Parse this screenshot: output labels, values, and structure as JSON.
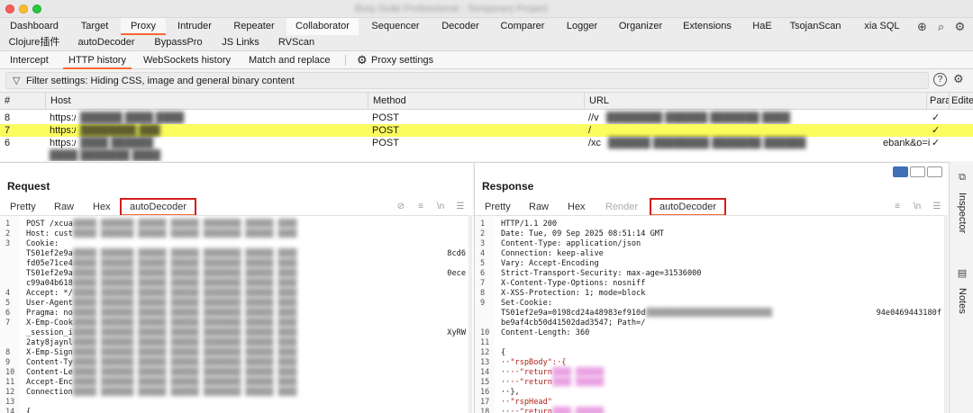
{
  "window": {
    "title": "Burp Suite Professional - Temporary Project"
  },
  "main_tabs_row1": [
    "Dashboard",
    "Target",
    "Proxy",
    "Intruder",
    "Repeater",
    "Collaborator",
    "Sequencer",
    "Decoder",
    "Comparer",
    "Logger",
    "Organizer",
    "Extensions",
    "HaE",
    "TsojanScan",
    "xia SQL"
  ],
  "main_tabs_row2": [
    "Clojure插件",
    "autoDecoder",
    "BypassPro",
    "JS Links",
    "RVScan"
  ],
  "active_main_tab": "Proxy",
  "proxy_tabs": [
    "Intercept",
    "HTTP history",
    "WebSockets history",
    "Match and replace"
  ],
  "proxy_settings_label": "Proxy settings",
  "active_proxy_tab": "HTTP history",
  "filter": {
    "text": "Filter settings: Hiding CSS, image and general binary content"
  },
  "history_table": {
    "columns": [
      "#",
      "Host",
      "Method",
      "URL",
      "Para",
      "Edite"
    ],
    "rows": [
      {
        "num": "8",
        "host": "https://",
        "method": "POST",
        "url": "//v",
        "params": "✓",
        "selected": false
      },
      {
        "num": "7",
        "host": "https://",
        "method": "POST",
        "url": "/",
        "params": "✓",
        "selected": true
      },
      {
        "num": "6",
        "host": "https://",
        "method": "POST",
        "url": "/xc",
        "url_tail": "ebank&o=i",
        "params": "✓",
        "selected": false
      }
    ]
  },
  "request_panel": {
    "title": "Request",
    "tabs": [
      "Pretty",
      "Raw",
      "Hex",
      "autoDecoder"
    ],
    "active_tab": "autoDecoder",
    "lines": [
      {
        "n": "1",
        "text": "POST /xcua"
      },
      {
        "n": "2",
        "text": "Host: cust"
      },
      {
        "n": "3",
        "text": "Cookie:"
      },
      {
        "n": "",
        "text": "TS01ef2e9a",
        "tail": "8cd6"
      },
      {
        "n": "",
        "text": "fd05e71ce4"
      },
      {
        "n": "",
        "text": "TS01ef2e9a",
        "tail": "0ece"
      },
      {
        "n": "",
        "text": "c99a04b618"
      },
      {
        "n": "4",
        "text": "Accept: */"
      },
      {
        "n": "5",
        "text": "User-Agent"
      },
      {
        "n": "6",
        "text": "Pragma: no"
      },
      {
        "n": "7",
        "text": "X-Emp-Cook"
      },
      {
        "n": "",
        "text": "_session_i",
        "tail": "XyRW"
      },
      {
        "n": "",
        "text": "2aty8jaynl"
      },
      {
        "n": "8",
        "text": "X-Emp-Sign"
      },
      {
        "n": "9",
        "text": "Content-Ty"
      },
      {
        "n": "10",
        "text": "Content-Le"
      },
      {
        "n": "11",
        "text": "Accept-Enc"
      },
      {
        "n": "12",
        "text": "Connection"
      },
      {
        "n": "13",
        "text": ""
      },
      {
        "n": "14",
        "text": "{"
      }
    ]
  },
  "response_panel": {
    "title": "Response",
    "tabs": [
      "Pretty",
      "Raw",
      "Hex",
      "Render",
      "autoDecoder"
    ],
    "active_tab": "autoDecoder",
    "lines": [
      {
        "n": "1",
        "text": "HTTP/1.1 200"
      },
      {
        "n": "2",
        "text": "Date: Tue, 09 Sep 2025 08:51:14 GMT"
      },
      {
        "n": "3",
        "text": "Content-Type: application/json"
      },
      {
        "n": "4",
        "text": "Connection: keep-alive"
      },
      {
        "n": "5",
        "text": "Vary: Accept-Encoding"
      },
      {
        "n": "6",
        "text": "Strict-Transport-Security: max-age=31536000"
      },
      {
        "n": "7",
        "text": "X-Content-Type-Options: nosniff"
      },
      {
        "n": "8",
        "text": "X-XSS-Protection: 1; mode=block"
      },
      {
        "n": "9",
        "text": "Set-Cookie:"
      },
      {
        "n": "",
        "text": "TS01ef2e9a=0198cd24a48983ef910d",
        "tail": "94e0469443180f"
      },
      {
        "n": "",
        "text": "be9af4cb50d41502dad3547; Path=/"
      },
      {
        "n": "10",
        "text": "Content-Length: 360"
      },
      {
        "n": "11",
        "text": ""
      },
      {
        "n": "12",
        "text": "{"
      },
      {
        "n": "13",
        "text": "··\"rspBody\":·{"
      },
      {
        "n": "14",
        "text": "····\"return"
      },
      {
        "n": "15",
        "text": "····\"return"
      },
      {
        "n": "16",
        "text": "··},"
      },
      {
        "n": "17",
        "text": "··\"rspHead\""
      },
      {
        "n": "18",
        "text": "····\"return"
      }
    ]
  },
  "sidebar": {
    "inspector": "Inspector",
    "notes": "Notes"
  },
  "colors": {
    "accent": "#ff6633",
    "selected_row": "#fcfc5e",
    "highlight_box": "#d41c1c"
  }
}
